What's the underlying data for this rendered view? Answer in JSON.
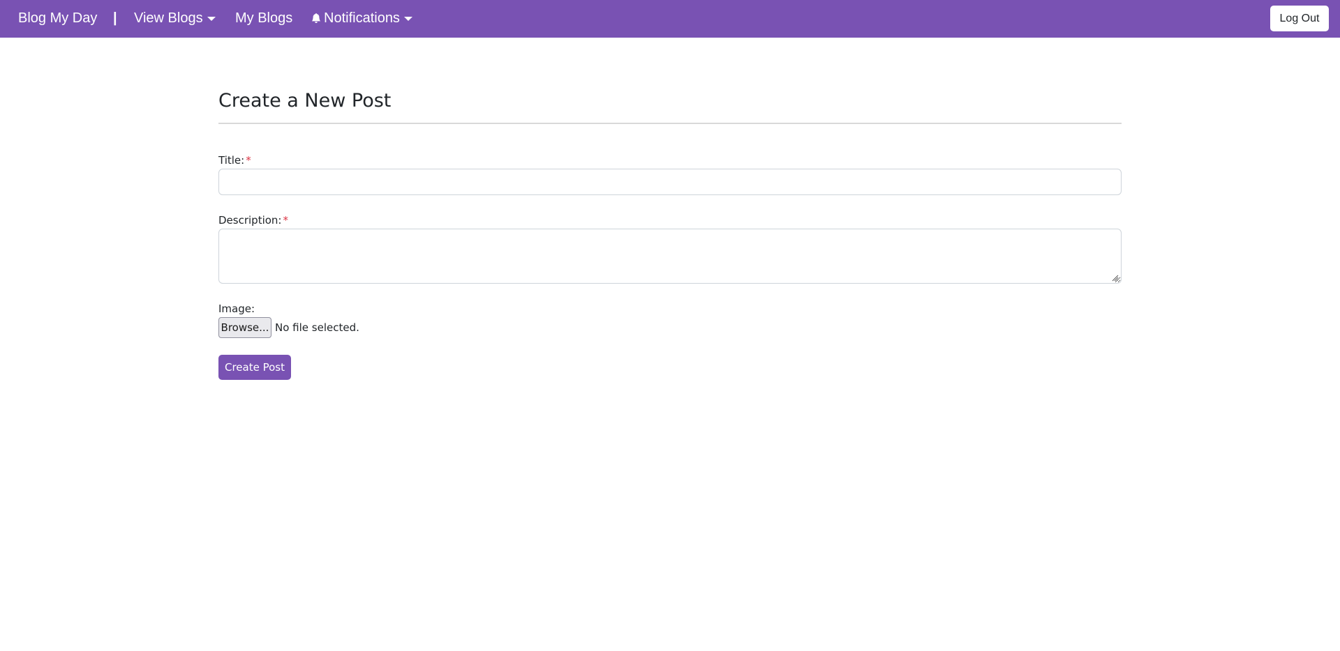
{
  "navbar": {
    "brand": "Blog My Day",
    "separator": "|",
    "view_blogs": "View Blogs",
    "my_blogs": "My Blogs",
    "notifications": "Notifications",
    "logout": "Log Out",
    "background_color": "#7952b3"
  },
  "form": {
    "heading": "Create a New Post",
    "title_label": "Title:",
    "title_value": "",
    "description_label": "Description:",
    "description_value": "",
    "required_mark": "*",
    "image_label": "Image:",
    "browse_label": "Browse...",
    "file_status": "No file selected.",
    "submit_label": "Create Post",
    "accent_color": "#7952b3",
    "required_color": "#dc3545"
  },
  "icons": {
    "notifications": "bell-icon",
    "dropdown": "caret-down-icon"
  }
}
